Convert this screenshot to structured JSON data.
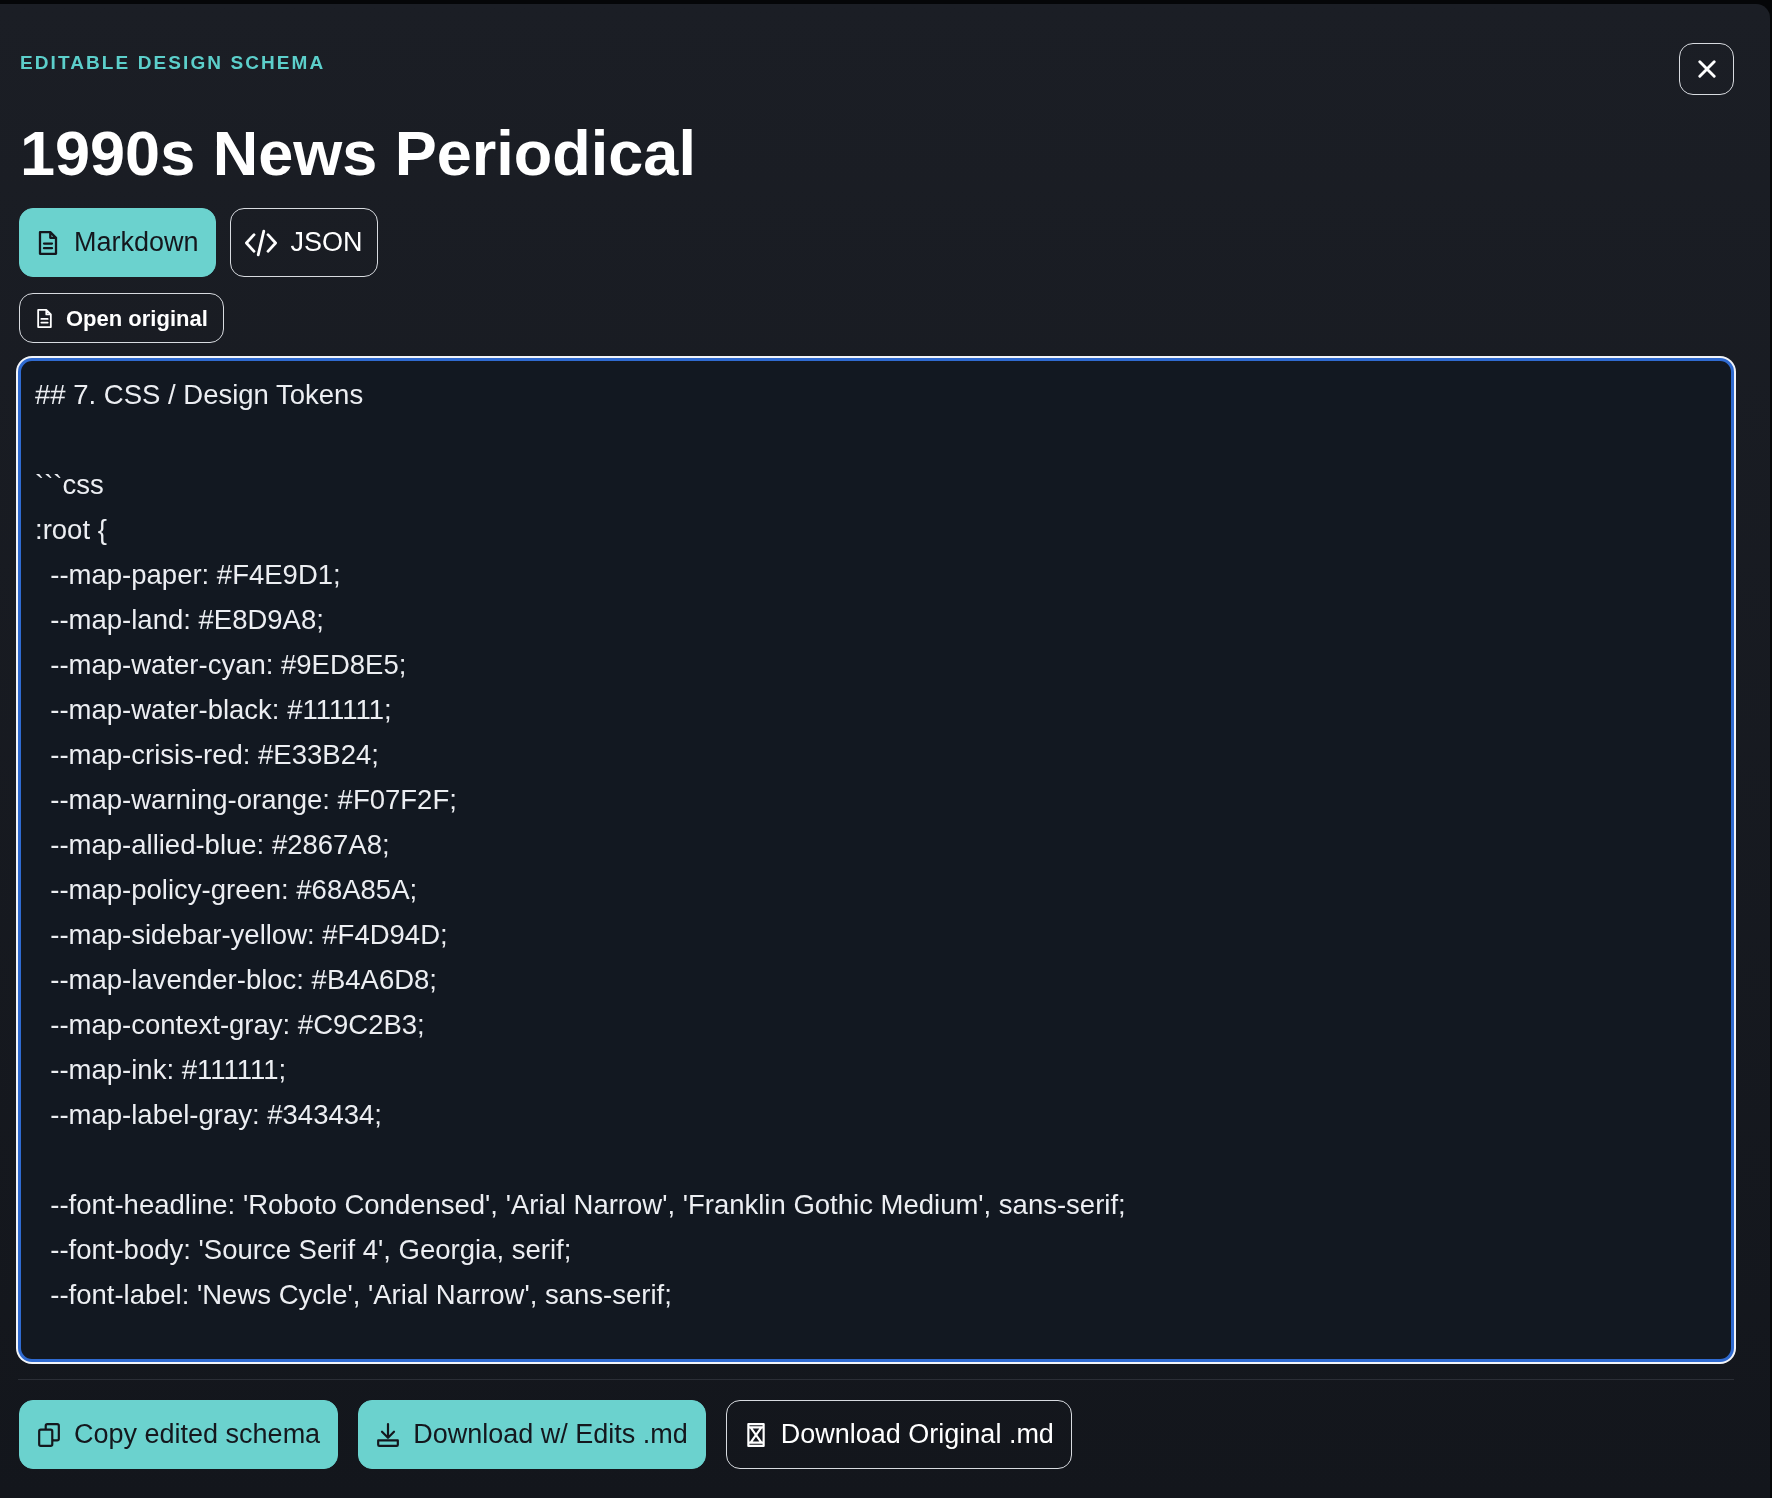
{
  "header": {
    "eyebrow": "EDITABLE DESIGN SCHEMA",
    "title": "1990s News Periodical"
  },
  "view_tabs": [
    {
      "label": "Markdown",
      "kind": "document",
      "selected": true
    },
    {
      "label": "JSON",
      "kind": "code",
      "selected": false
    }
  ],
  "open_original": {
    "label": "Open original"
  },
  "editor": {
    "blocks": [
      [
        "## 7. CSS / Design Tokens"
      ],
      [
        "```css",
        ":root {",
        "  --map-paper: #F4E9D1;",
        "  --map-land: #E8D9A8;",
        "  --map-water-cyan: #9ED8E5;",
        "  --map-water-black: #111111;",
        "  --map-crisis-red: #E33B24;",
        "  --map-warning-orange: #F07F2F;",
        "  --map-allied-blue: #2867A8;",
        "  --map-policy-green: #68A85A;",
        "  --map-sidebar-yellow: #F4D94D;",
        "  --map-lavender-bloc: #B4A6D8;",
        "  --map-context-gray: #C9C2B3;",
        "  --map-ink: #111111;",
        "  --map-label-gray: #343434;"
      ],
      [
        "  --font-headline: 'Roboto Condensed', 'Arial Narrow', 'Franklin Gothic Medium', sans-serif;",
        "  --font-body: 'Source Serif 4', Georgia, serif;",
        "  --font-label: 'News Cycle', 'Arial Narrow', sans-serif;"
      ]
    ]
  },
  "actions": [
    {
      "label": "Copy edited schema",
      "kind": "copy"
    },
    {
      "label": "Download w/ Edits .md",
      "kind": "download"
    },
    {
      "label": "Download Original .md",
      "kind": "download-original"
    }
  ]
}
